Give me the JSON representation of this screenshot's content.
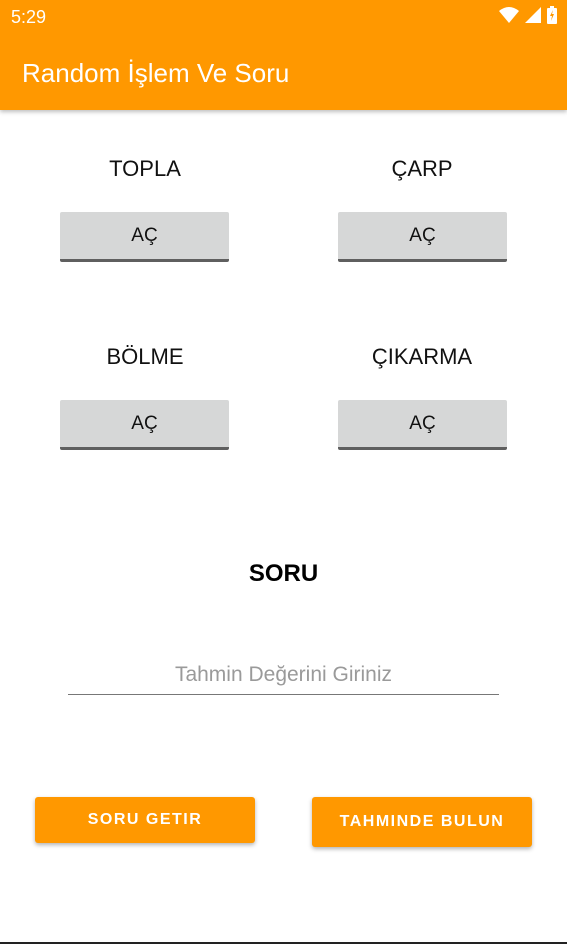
{
  "status_bar": {
    "time": "5:29"
  },
  "app_bar": {
    "title": "Random İşlem Ve Soru"
  },
  "operations": [
    {
      "label": "TOPLA",
      "button": "AÇ"
    },
    {
      "label": "ÇARP",
      "button": "AÇ"
    },
    {
      "label": "BÖLME",
      "button": "AÇ"
    },
    {
      "label": "ÇIKARMA",
      "button": "AÇ"
    }
  ],
  "question": {
    "text": "SORU"
  },
  "guess_input": {
    "value": "",
    "placeholder": "Tahmin Değerini Giriniz"
  },
  "actions": {
    "get_question": "SORU GETIR",
    "find_guess": "TAHMINDE BULUN"
  },
  "colors": {
    "accent": "#FF9800",
    "button_gray": "#d6d7d7"
  }
}
